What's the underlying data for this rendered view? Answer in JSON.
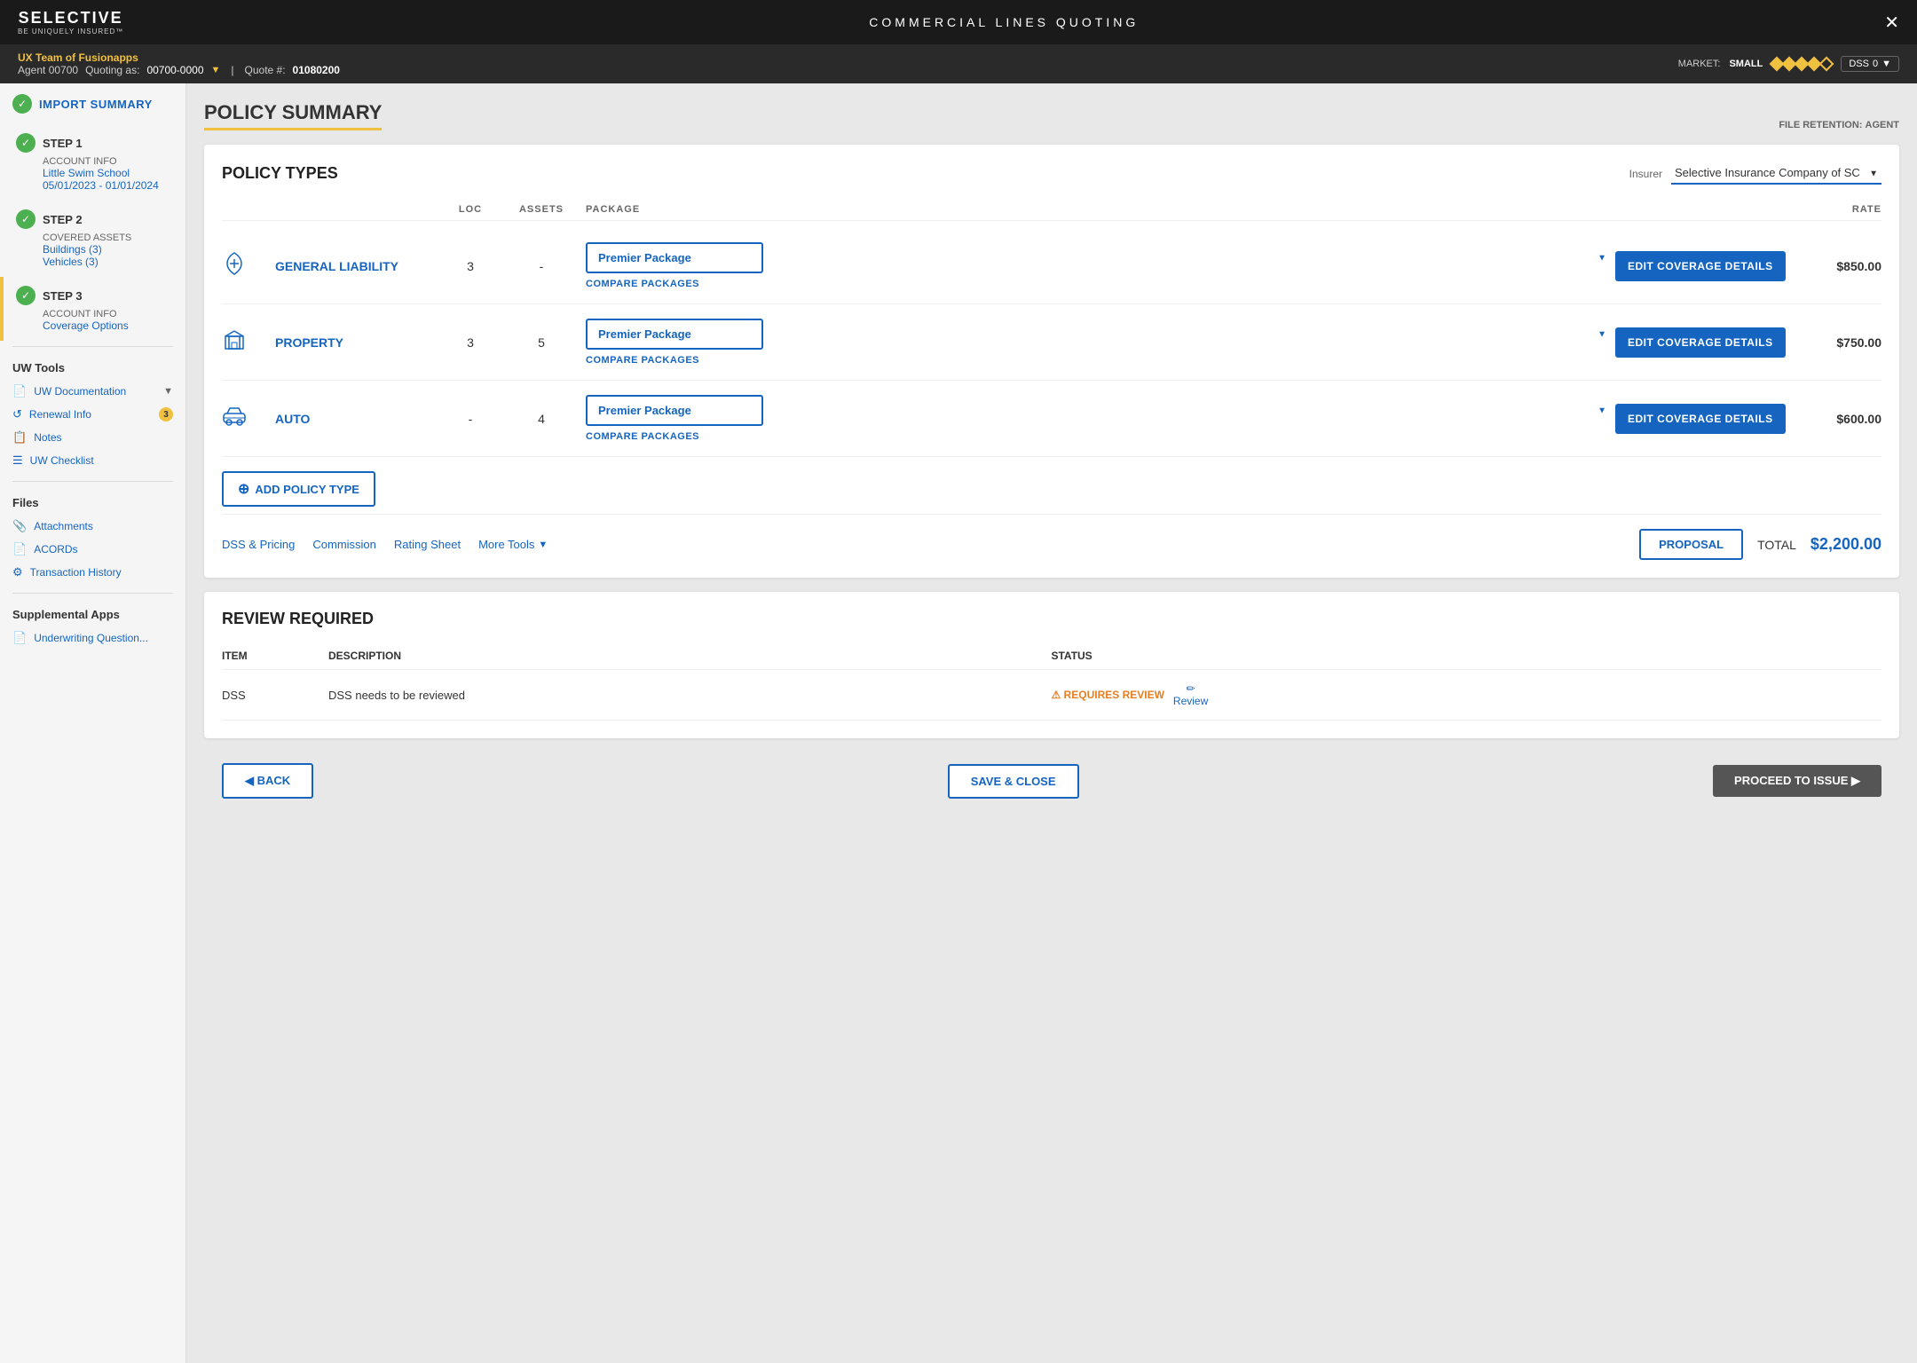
{
  "header": {
    "logo_main": "SELECTIVE",
    "logo_sub": "BE UNIQUELY INSURED™",
    "page_title": "COMMERCIAL LINES QUOTING",
    "close_label": "✕",
    "agent_team": "UX Team of Fusionapps",
    "agent_label": "Agent 00700",
    "quoting_as_label": "Quoting as:",
    "agent_number": "00700-0000",
    "quote_label": "Quote #:",
    "quote_number": "01080200",
    "market_label": "MARKET:",
    "market_value": "SMALL",
    "dss_label": "DSS",
    "dss_count": "0"
  },
  "sidebar": {
    "import_summary_label": "IMPORT SUMMARY",
    "steps": [
      {
        "number": "✓",
        "title": "STEP 1",
        "label": "ACCOUNT INFO",
        "links": [
          "Little Swim School",
          "05/01/2023 - 01/01/2024"
        ]
      },
      {
        "number": "✓",
        "title": "STEP 2",
        "label": "COVERED ASSETS",
        "links": [
          "Buildings (3)",
          "Vehicles (3)"
        ]
      },
      {
        "number": "✓",
        "title": "STEP 3",
        "label": "ACCOUNT INFO",
        "links": [
          "Coverage Options"
        ],
        "active": true
      }
    ],
    "uw_tools_title": "UW Tools",
    "uw_tools": [
      {
        "label": "UW Documentation",
        "has_chevron": true,
        "badge": null
      },
      {
        "label": "Renewal Info",
        "has_chevron": false,
        "badge": "3"
      },
      {
        "label": "Notes",
        "has_chevron": false,
        "badge": null
      },
      {
        "label": "UW Checklist",
        "has_chevron": false,
        "badge": null
      }
    ],
    "files_title": "Files",
    "files": [
      {
        "label": "Attachments"
      },
      {
        "label": "ACORDs"
      },
      {
        "label": "Transaction History"
      }
    ],
    "supplemental_title": "Supplemental Apps",
    "supplemental": [
      {
        "label": "Underwriting Question..."
      }
    ]
  },
  "main": {
    "page_title": "POLICY SUMMARY",
    "file_retention_label": "FILE RETENTION:",
    "file_retention_value": "AGENT",
    "policy_types_title": "POLICY TYPES",
    "insurer_label": "Insurer",
    "insurer_value": "Selective Insurance Company of SC",
    "table_headers": {
      "icon": "",
      "name": "",
      "loc": "LOC",
      "assets": "ASSETS",
      "package": "PACKAGE",
      "edit": "",
      "rate": "RATE"
    },
    "policies": [
      {
        "icon": "⚡",
        "name": "GENERAL LIABILITY",
        "loc": "3",
        "assets": "-",
        "package": "Premier Package",
        "edit_label": "EDIT COVERAGE DETAILS",
        "compare_label": "COMPARE PACKAGES",
        "rate": "$850.00"
      },
      {
        "icon": "🏢",
        "name": "PROPERTY",
        "loc": "3",
        "assets": "5",
        "package": "Premier Package",
        "edit_label": "EDIT COVERAGE DETAILS",
        "compare_label": "COMPARE PACKAGES",
        "rate": "$750.00"
      },
      {
        "icon": "🚗",
        "name": "AUTO",
        "loc": "-",
        "assets": "4",
        "package": "Premier Package",
        "edit_label": "EDIT COVERAGE DETAILS",
        "compare_label": "COMPARE PACKAGES",
        "rate": "$600.00"
      }
    ],
    "add_policy_label": "ADD POLICY TYPE",
    "footer": {
      "links": [
        "DSS & Pricing",
        "Commission",
        "Rating Sheet"
      ],
      "more_tools_label": "More Tools",
      "proposal_label": "PROPOSAL",
      "total_label": "TOTAL",
      "total_amount": "$2,200.00"
    },
    "review_section": {
      "title": "REVIEW REQUIRED",
      "col_item": "ITEM",
      "col_description": "DESCRIPTION",
      "col_status": "STATUS",
      "rows": [
        {
          "item": "DSS",
          "description": "DSS needs to be reviewed",
          "status": "⚠ REQUIRES REVIEW",
          "action": "Review"
        }
      ]
    }
  },
  "bottom_bar": {
    "back_label": "◀ BACK",
    "save_close_label": "SAVE & CLOSE",
    "proceed_label": "PROCEED TO ISSUE ▶"
  }
}
